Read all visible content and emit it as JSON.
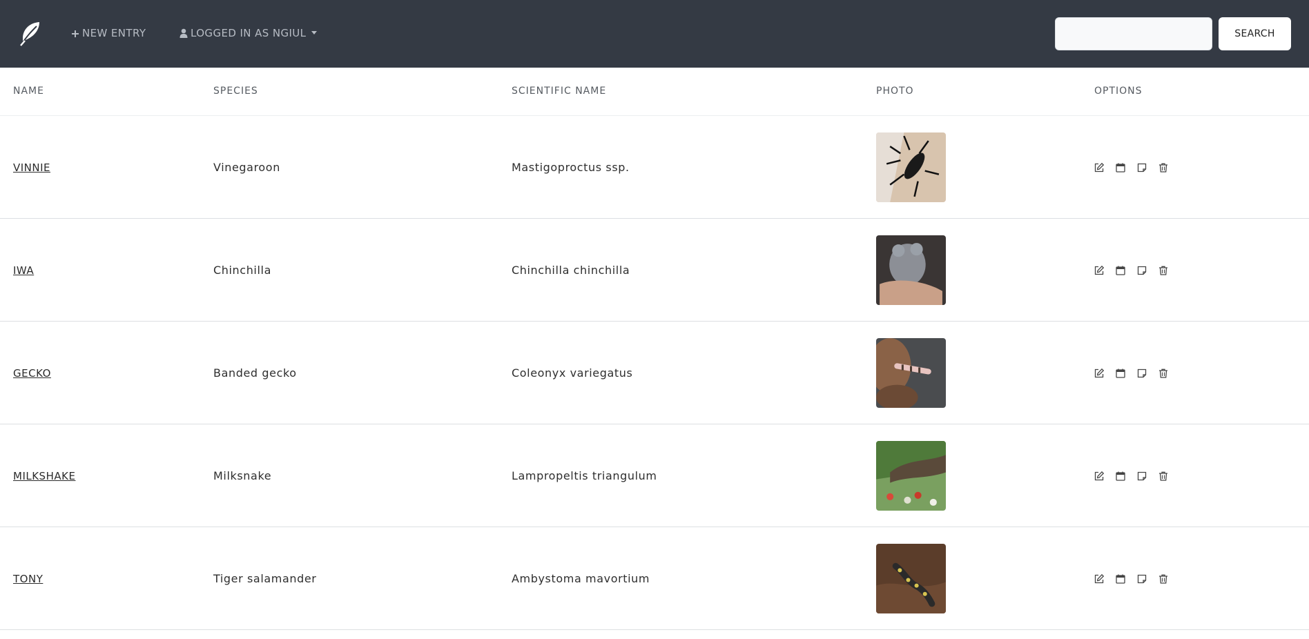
{
  "nav": {
    "new_entry": "NEW ENTRY",
    "user": "LOGGED IN AS NGIUL",
    "search_value": "",
    "search_label": "SEARCH"
  },
  "table": {
    "headers": [
      "NAME",
      "SPECIES",
      "SCIENTIFIC NAME",
      "PHOTO",
      "OPTIONS"
    ],
    "rows": [
      {
        "name": "VINNIE",
        "species": "Vinegaroon",
        "scientific": "Mastigoproctus ssp."
      },
      {
        "name": "IWA",
        "species": "Chinchilla",
        "scientific": "Chinchilla chinchilla"
      },
      {
        "name": "GECKO",
        "species": "Banded gecko",
        "scientific": "Coleonyx variegatus"
      },
      {
        "name": "MILKSHAKE",
        "species": "Milksnake",
        "scientific": "Lampropeltis triangulum"
      },
      {
        "name": "TONY",
        "species": "Tiger salamander",
        "scientific": "Ambystoma mavortium"
      }
    ]
  },
  "icons": {
    "brand": "feather-icon",
    "new_entry": "plus-icon",
    "user": "person-icon",
    "options": [
      "edit-icon",
      "calendar-icon",
      "note-icon",
      "trash-icon"
    ]
  },
  "colors": {
    "navbar": "#343a44",
    "nav_text": "#b7bcc4",
    "row_divider": "#dcdfe2"
  }
}
